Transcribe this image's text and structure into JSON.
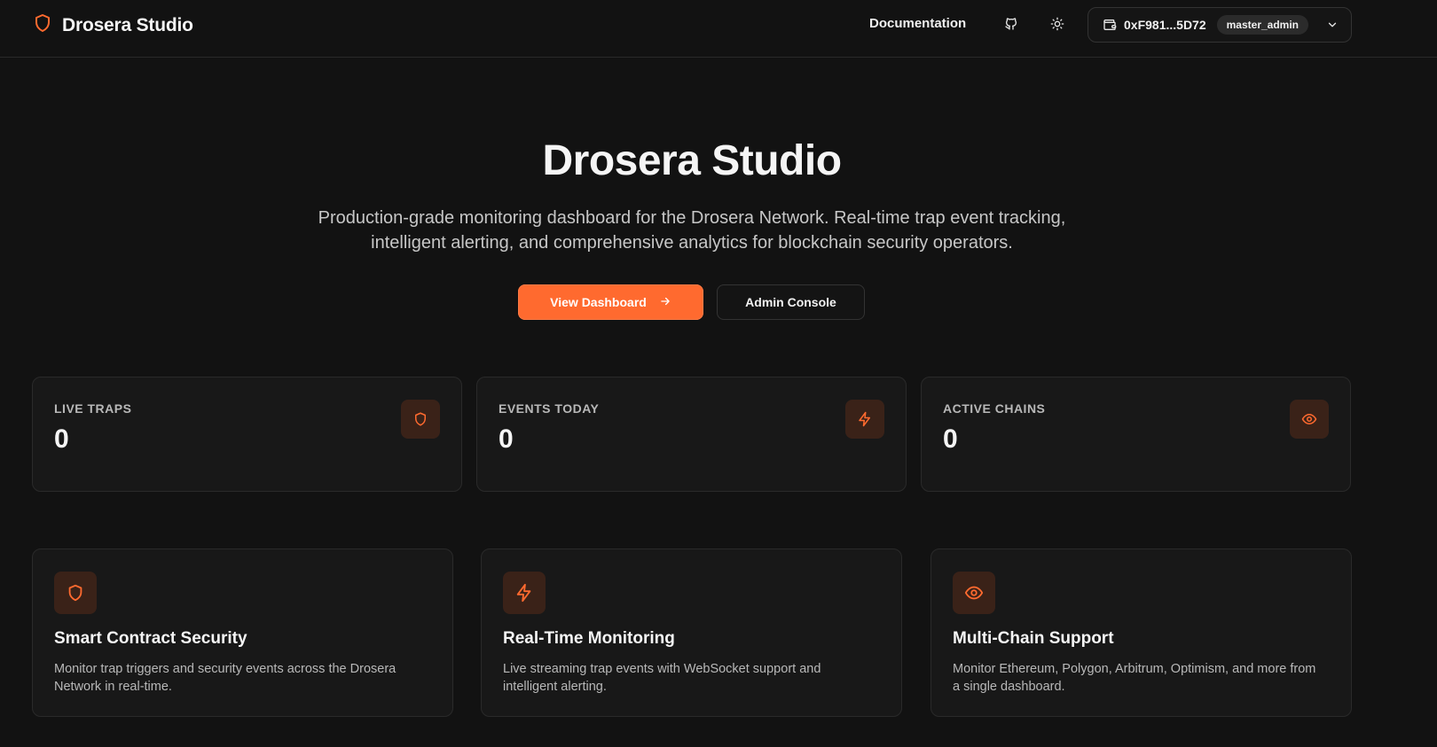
{
  "colors": {
    "background": "#121212",
    "accent": "#ff6a2f",
    "card": "#181818",
    "icon_tile": "#3a2218"
  },
  "header": {
    "brand_icon": "shield-icon",
    "brand_name": "Drosera Studio",
    "documentation_label": "Documentation",
    "github_icon": "github-icon",
    "theme_icon": "sun-icon",
    "wallet": {
      "icon": "wallet-icon",
      "address": "0xF981...5D72",
      "role": "master_admin",
      "menu_icon": "chevron-down-icon"
    }
  },
  "hero": {
    "title": "Drosera Studio",
    "description": "Production-grade monitoring dashboard for the Drosera Network. Real-time trap event tracking, intelligent alerting, and comprehensive analytics for blockchain security operators.",
    "primary_button": "View Dashboard",
    "primary_button_icon": "arrow-right-icon",
    "secondary_button": "Admin Console"
  },
  "stats": [
    {
      "label": "LIVE TRAPS",
      "value": "0",
      "icon": "shield-icon"
    },
    {
      "label": "EVENTS TODAY",
      "value": "0",
      "icon": "lightning-icon"
    },
    {
      "label": "ACTIVE CHAINS",
      "value": "0",
      "icon": "eye-icon"
    }
  ],
  "features": [
    {
      "icon": "shield-icon",
      "title": "Smart Contract Security",
      "description": "Monitor trap triggers and security events across the Drosera Network in real-time."
    },
    {
      "icon": "lightning-icon",
      "title": "Real-Time Monitoring",
      "description": "Live streaming trap events with WebSocket support and intelligent alerting."
    },
    {
      "icon": "eye-icon",
      "title": "Multi-Chain Support",
      "description": "Monitor Ethereum, Polygon, Arbitrum, Optimism, and more from a single dashboard."
    }
  ]
}
